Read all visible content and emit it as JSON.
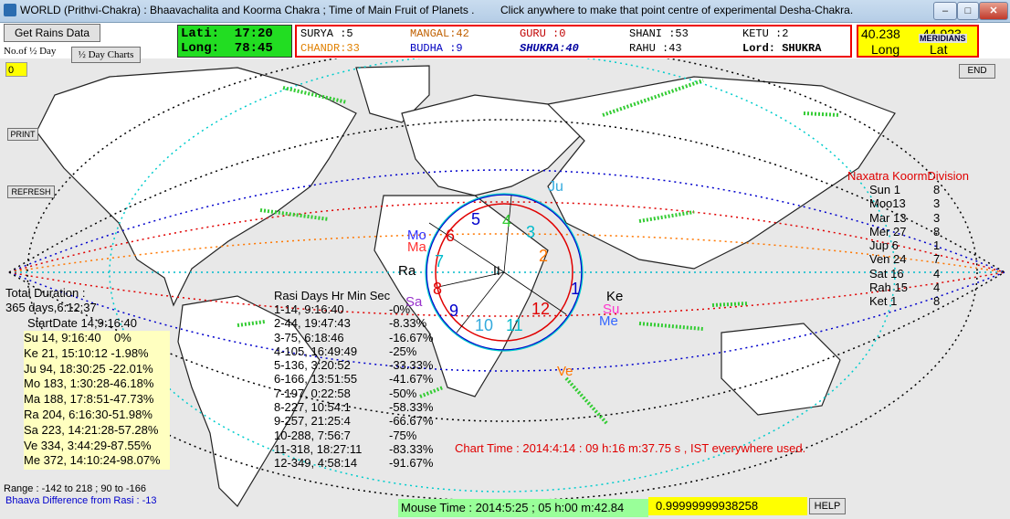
{
  "window": {
    "title": "WORLD (Prithvi-Chakra) : Bhaavachalita and Koorma Chakra ; Time of Main Fruit of Planets .",
    "hint": "Click anywhere to make that point centre of experimental Desha-Chakra.",
    "min_label": "–",
    "max_label": "□",
    "close_label": "✕"
  },
  "toolbar": {
    "get_rains": "Get Rains Data",
    "half_day_label": "No.of ½ Day",
    "half_day_charts": "½ Day Charts",
    "half_day_value": "0",
    "print": "PRINT",
    "refresh": "REFRESH",
    "end": "END",
    "help": "HELP"
  },
  "location": {
    "lati": "Lati:  17:20",
    "long": "Long:  78:45"
  },
  "planets": [
    {
      "label": "SURYA  :5",
      "color": "#000000"
    },
    {
      "label": "MANGAL:42",
      "color": "#c06000"
    },
    {
      "label": "GURU   :0",
      "color": "#c00000"
    },
    {
      "label": "SHANI  :53",
      "color": "#000000"
    },
    {
      "label": "KETU  :2",
      "color": "#000000"
    },
    {
      "label": "CHANDR:33",
      "color": "#e08000"
    },
    {
      "label": "BUDHA  :9",
      "color": "#0000c0"
    },
    {
      "label": "SHUKRA:40",
      "color": "#0000a0"
    },
    {
      "label": "RAHU  :43",
      "color": "#000000"
    },
    {
      "label": "Lord: SHUKRA",
      "color": "#000000"
    }
  ],
  "coords": {
    "long_value": "40.238",
    "lat_value": "44.923",
    "long_label": "Long",
    "lat_label": "Lat",
    "meridians": "MERIDIANS"
  },
  "total_duration": {
    "label": "Total Duration :",
    "value": "365 days,6:12:37",
    "start": "StartDate 14,9:16:40"
  },
  "dasa_list": [
    "Su 14, 9:16:40    0%",
    "Ke 21, 15:10:12 -1.98%",
    "Ju 94, 18:30:25 -22.01%",
    "Mo 183, 1:30:28-46.18%",
    "Ma 188, 17:8:51-47.73%",
    "Ra 204, 6:16:30-51.98%",
    "Sa 223, 14:21:28-57.28%",
    "Ve 334, 3:44:29-87.55%",
    "Me 372, 14:10:24-98.07%"
  ],
  "rasi_table": {
    "header": "Rasi Days Hr Min Sec",
    "rows": [
      [
        "1-14, 9:16:40",
        "-0%"
      ],
      [
        "2-44, 19:47:43",
        "-8.33%"
      ],
      [
        "3-75, 6:18:46",
        "-16.67%"
      ],
      [
        "4-105, 16:49:49",
        "-25%"
      ],
      [
        "5-136, 3:20:52",
        "-33.33%"
      ],
      [
        "6-166, 13:51:55",
        "-41.67%"
      ],
      [
        "7-197, 0:22:58",
        "-50%"
      ],
      [
        "8-227, 10:54:1",
        "-58.33%"
      ],
      [
        "9-257, 21:25:4",
        "-66.67%"
      ],
      [
        "10-288, 7:56:7",
        "-75%"
      ],
      [
        "11-318, 18:27:11",
        "-83.33%"
      ],
      [
        "12-349, 4:58:14",
        "-91.67%"
      ]
    ]
  },
  "naxatra": {
    "title": "Naxatra KoormDivision",
    "rows": [
      [
        "Sun 1",
        "8"
      ],
      [
        "Moo13",
        "3"
      ],
      [
        "Mar 13",
        "3"
      ],
      [
        "Mer 27",
        "8"
      ],
      [
        "Jup 6",
        "1"
      ],
      [
        "Ven 24",
        "7"
      ],
      [
        "Sat 16",
        "4"
      ],
      [
        "Rah 15",
        "4"
      ],
      [
        "Ket 1",
        "8"
      ]
    ]
  },
  "chart_time": "Chart Time : 2014:4:14 : 09 h:16 m:37.75 s , IST everywhere used.",
  "mouse_time": "Mouse Time : 2014:5:25 ; 05 h:00 m:42.84",
  "mouse_value": "0.99999999938258",
  "range_text": "Range : -142 to 218 ; 90 to -166",
  "bhaava_text": "Bhaava Difference from Rasi : -13",
  "chakra": {
    "numbers": [
      "1",
      "2",
      "3",
      "4",
      "5",
      "6",
      "7",
      "8",
      "9",
      "10",
      "11",
      "12"
    ],
    "planets": [
      "Ju",
      "Mo",
      "Ma",
      "Ra",
      "Sa",
      "Ke",
      "Su",
      "Me",
      "Ve"
    ],
    "ra_label": "Ra",
    "center_label": "II"
  },
  "colors": {
    "accent_green": "#33cc33",
    "border_red": "#ff0000",
    "yellow": "#ffff00",
    "circle_red": "#e00000",
    "circle_blue": "#0000cc"
  }
}
